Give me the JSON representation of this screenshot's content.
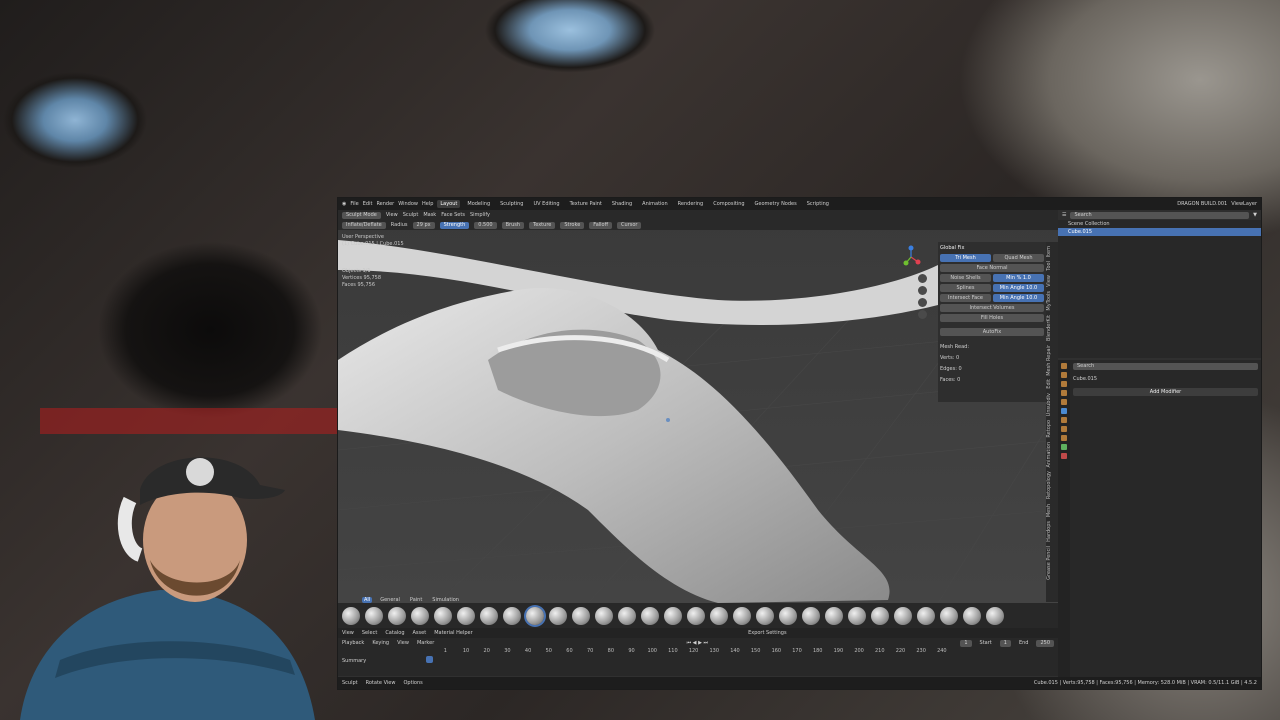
{
  "topbar": {
    "menus": [
      "File",
      "Edit",
      "Render",
      "Window",
      "Help"
    ],
    "workspaces": [
      "Layout",
      "Modeling",
      "Sculpting",
      "UV Editing",
      "Texture Paint",
      "Shading",
      "Animation",
      "Rendering",
      "Compositing",
      "Geometry Nodes",
      "Scripting"
    ],
    "active_workspace": "Layout",
    "file_title": "DRAGON BUILD.001",
    "view_layer": "ViewLayer"
  },
  "viewport": {
    "mode": "Sculpt Mode",
    "menus": [
      "View",
      "Sculpt",
      "Mask",
      "Face Sets"
    ],
    "simplify": "Simplify",
    "brush": "Inflate/Deflate",
    "radius_label": "Radius",
    "radius_value": "29 px",
    "strength_label": "Strength",
    "strength_value": "0.500",
    "tool_menus": [
      "Brush",
      "Texture",
      "Stroke",
      "Falloff",
      "Cursor"
    ],
    "view_label": "User Perspective",
    "view_object": "(1) Cube.015 | Cube.015",
    "stats": [
      "Objects   1/1",
      "Vertices  95,758",
      "Faces     95,756"
    ]
  },
  "npanel": {
    "global_fix": "Global Fix",
    "tri_mesh": "Tri Mesh",
    "quad_mesh": "Quad Mesh",
    "face_normal": "Face Normal",
    "noise_shells": "Noise Shells",
    "min_pct": "Min %   1.0",
    "splines": "Splines",
    "min_angle_1": "Min Angle   10.0",
    "intersect_faces": "Intersect Face",
    "min_angle_2": "Min Angle   10.0",
    "intersect_volumes": "Intersect Volumes",
    "fill_holes": "Fill Holes",
    "autofix": "AutoFix",
    "mesh_read": "Mesh Read:",
    "verts": "Verts: 0",
    "edges": "Edges: 0",
    "faces": "Faces: 0",
    "tabs": [
      "Item",
      "Tool",
      "View",
      "MyTools",
      "BlenderKit",
      "Mesh Repair",
      "Edit",
      "Unsubdiv",
      "Retopo",
      "Animation",
      "Retopology",
      "Mesh",
      "Hardops",
      "Grease Pencil"
    ]
  },
  "brushbar": {
    "tabs": [
      "All",
      "General",
      "Paint",
      "Simulation"
    ],
    "active_tab": "All"
  },
  "shader": {
    "menus": [
      "View",
      "Select",
      "Catalog",
      "Asset"
    ],
    "material_helper": "Material Helper",
    "export_settings": "Export Settings"
  },
  "timeline": {
    "playback": "Playback",
    "keying": "Keying",
    "view": "View",
    "marker": "Marker",
    "current_frame": "1",
    "start_label": "Start",
    "start_value": "1",
    "end_label": "End",
    "end_value": "250",
    "ruler": [
      "1",
      "10",
      "20",
      "30",
      "40",
      "50",
      "60",
      "70",
      "80",
      "90",
      "100",
      "110",
      "120",
      "130",
      "140",
      "150",
      "160",
      "170",
      "180",
      "190",
      "200",
      "210",
      "220",
      "230",
      "240"
    ],
    "summary": "Summary"
  },
  "outliner": {
    "search_placeholder": "Search",
    "scene_collection": "Scene Collection",
    "object": "Cube.015"
  },
  "properties": {
    "search_placeholder": "Search",
    "object": "Cube.015",
    "add_modifier": "Add Modifier"
  },
  "statusbar": {
    "left": [
      "Sculpt",
      "Rotate View",
      "Options"
    ],
    "right": "Cube.015 | Verts:95,758 | Faces:95,756 | Memory: 528.0 MiB | VRAM: 0.5/11.1 GiB | 4.5.2"
  },
  "colors": {
    "accent": "#4772b3",
    "panel": "#303030",
    "header": "#1d1d1d"
  }
}
